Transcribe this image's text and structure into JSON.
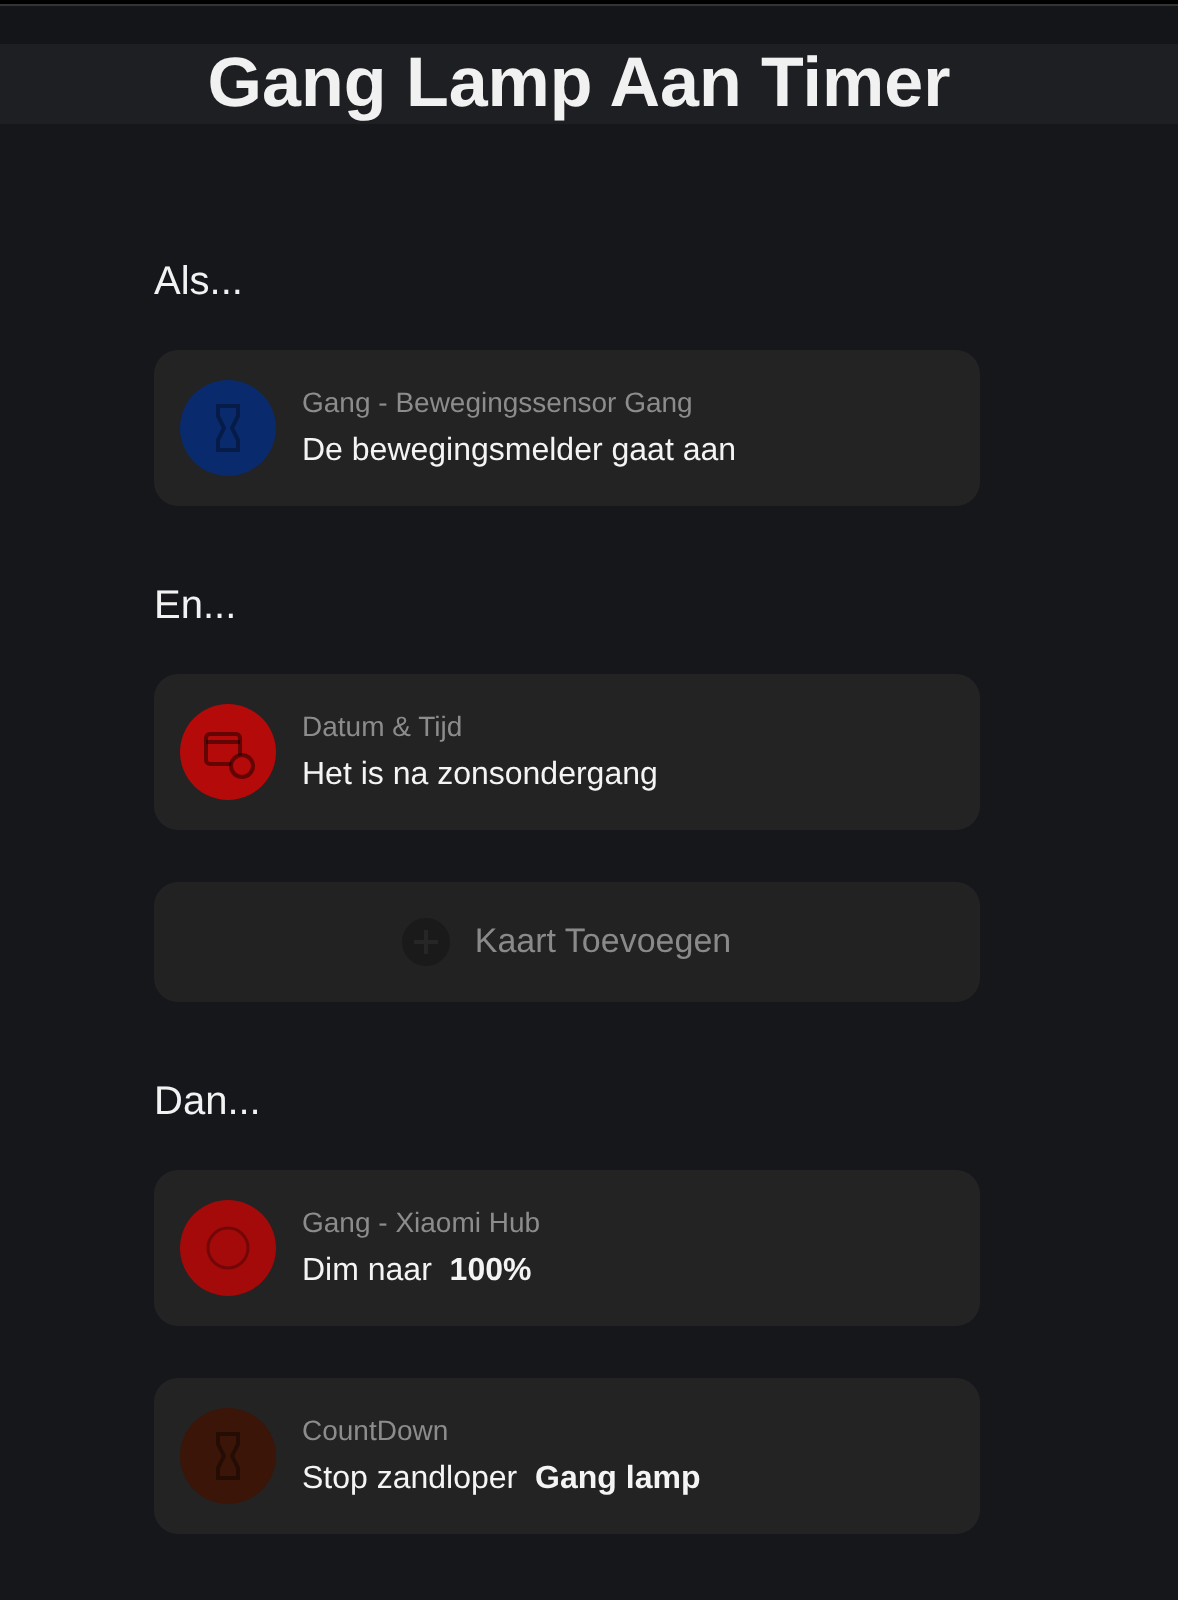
{
  "title": "Gang Lamp Aan Timer",
  "sections": [
    {
      "heading": "Als...",
      "items": [
        {
          "kind": "sensor",
          "color": "#0a2a6e",
          "device": "Gang - Bewegingssensor Gang",
          "text": "De bewegingsmelder gaat aan"
        }
      ]
    },
    {
      "heading": "En...",
      "items": [
        {
          "kind": "datetime",
          "color": "#b50a0a",
          "device": "Datum & Tijd",
          "text": "Het is na zonsondergang"
        },
        {
          "kind": "add",
          "label": "Kaart Toevoegen"
        }
      ]
    },
    {
      "heading": "Dan...",
      "items": [
        {
          "kind": "device",
          "color": "#a50a0a",
          "device": "Gang - Xiaomi Hub",
          "text": "Dim naar  **100%**"
        },
        {
          "kind": "timer",
          "color": "#3a1508",
          "device": "CountDown",
          "text": "Stop zandloper  **Gang lamp**"
        }
      ]
    }
  ]
}
